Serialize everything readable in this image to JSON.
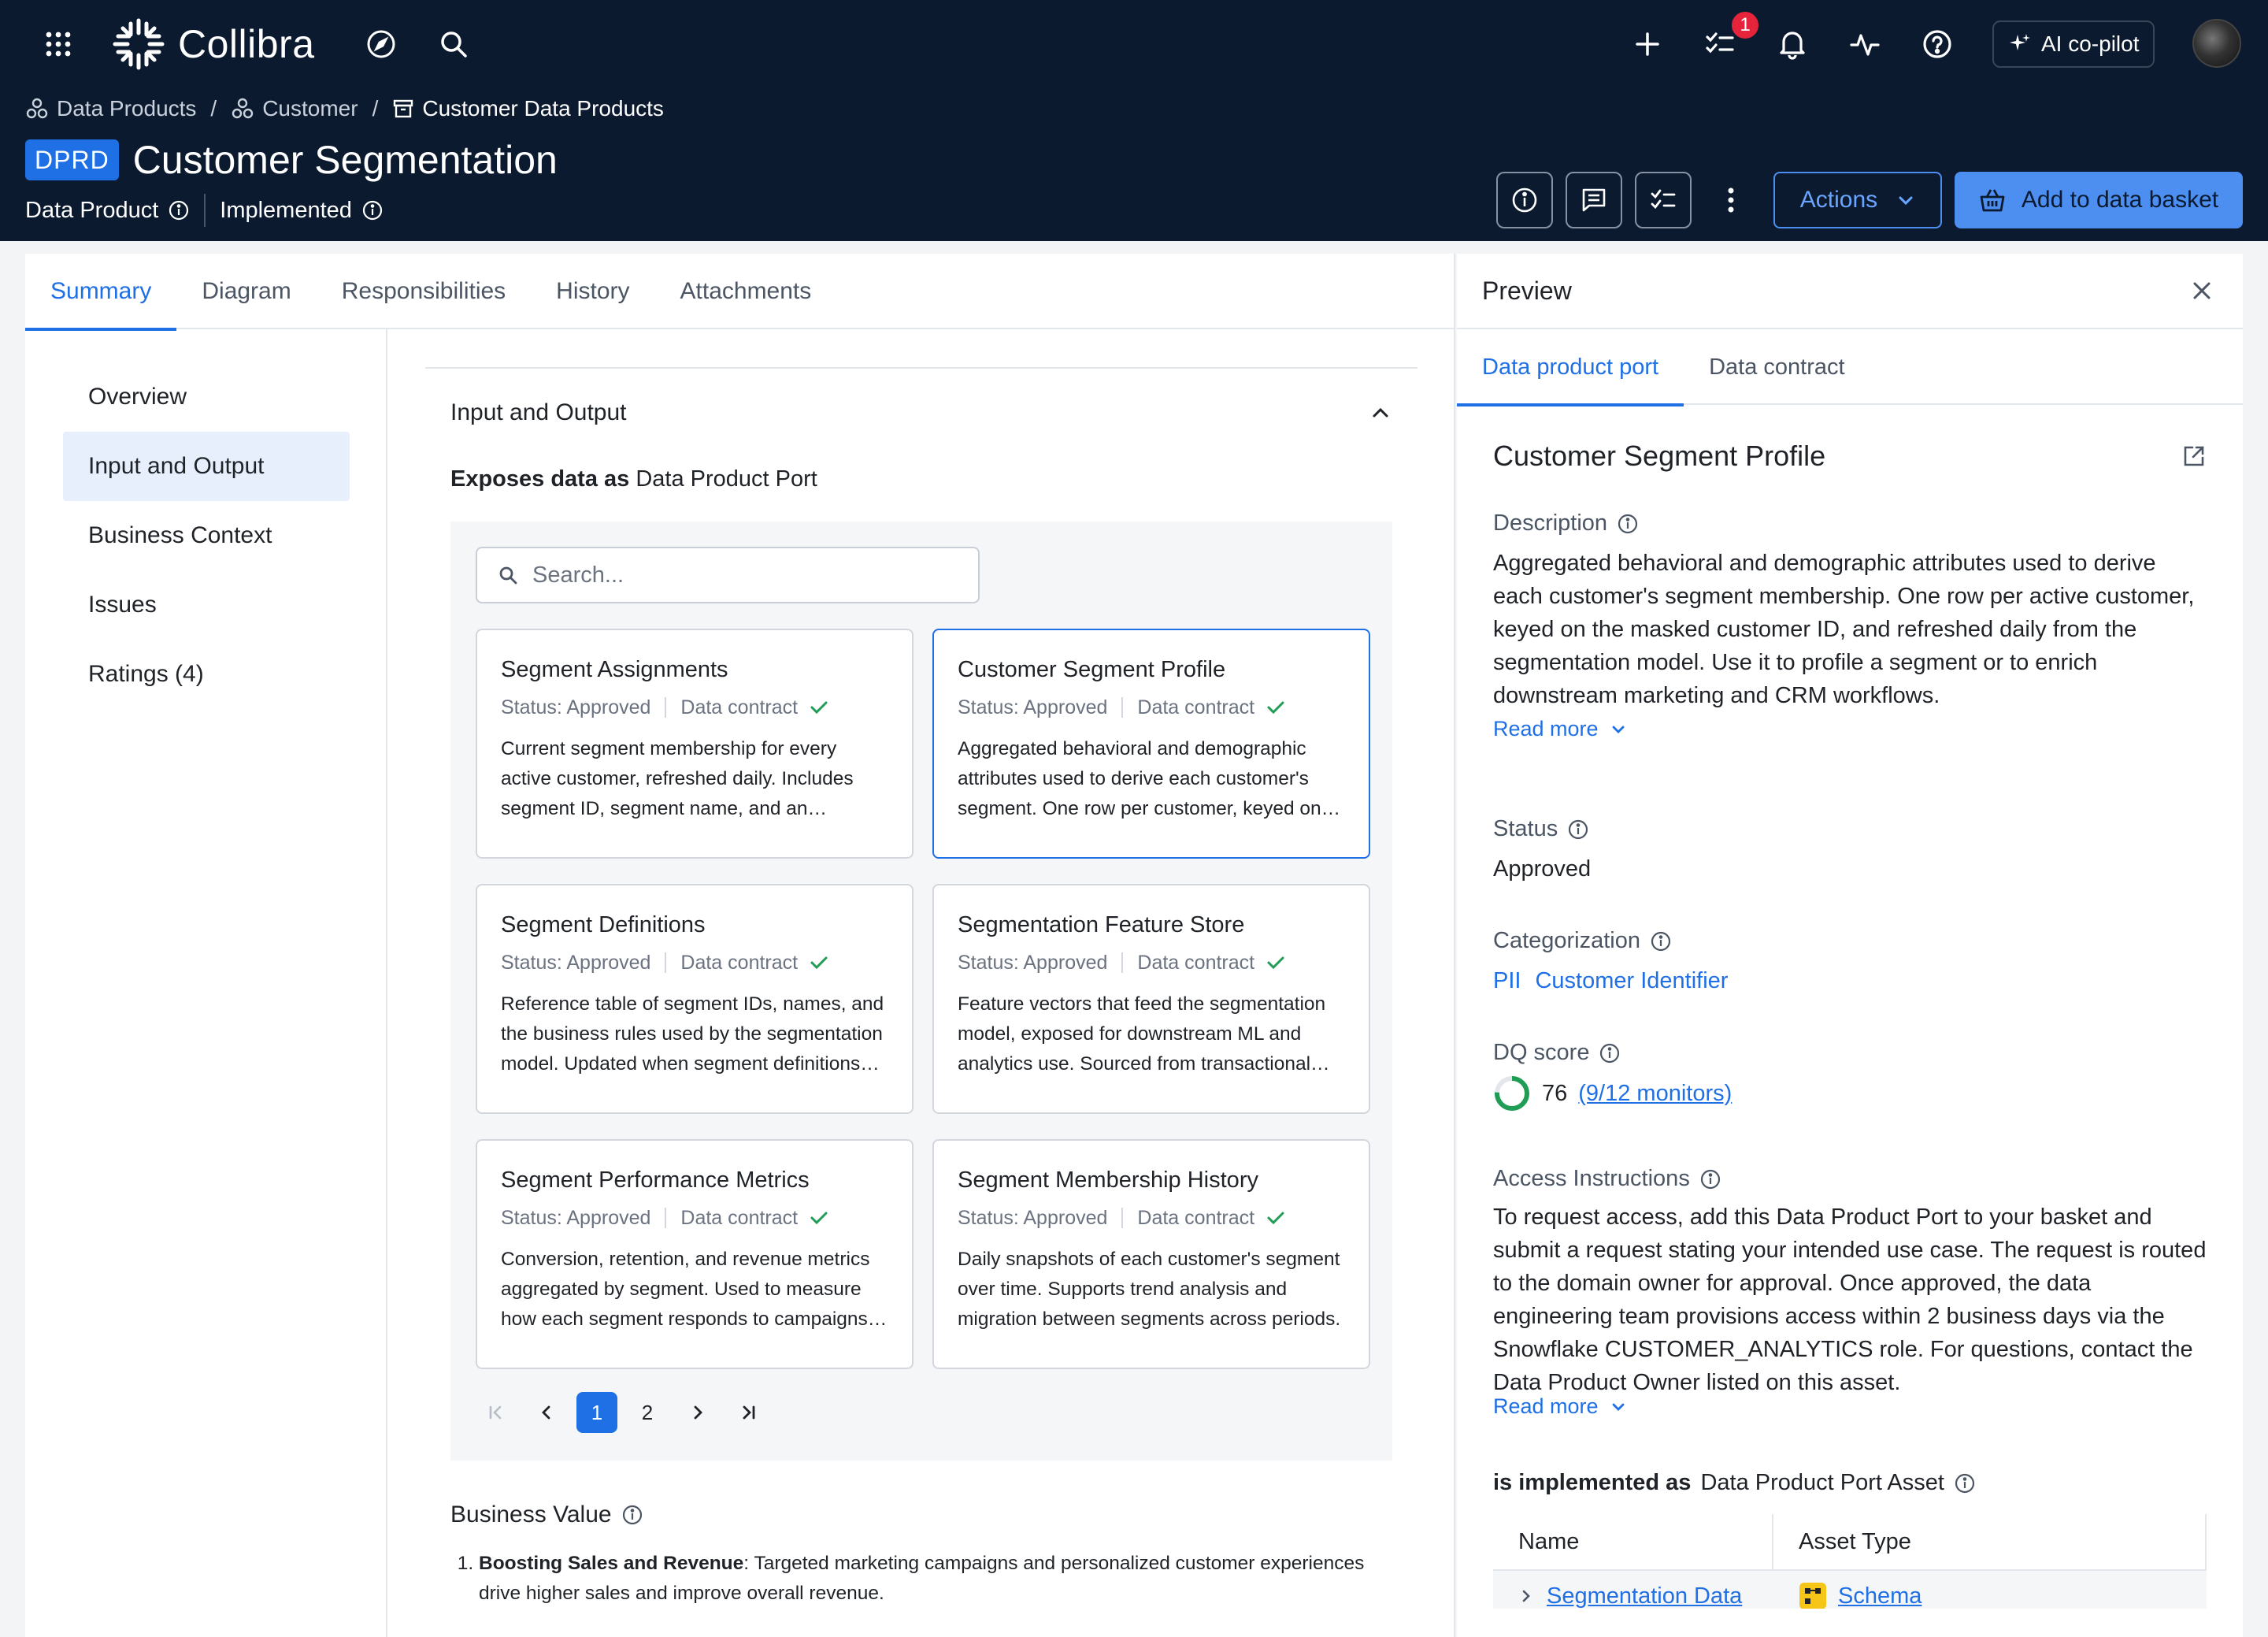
{
  "app": {
    "brand": "Collibra",
    "notifications_count": "1",
    "copilot_label": "AI co-pilot"
  },
  "breadcrumb": [
    {
      "label": "Data Products"
    },
    {
      "label": "Customer"
    },
    {
      "label": "Customer Data Products"
    }
  ],
  "asset": {
    "type_badge": "DPRD",
    "title": "Customer Segmentation",
    "type": "Data Product",
    "status": "Implemented"
  },
  "header_actions": {
    "actions_label": "Actions",
    "basket_label": "Add to data basket"
  },
  "tabs": [
    {
      "label": "Summary",
      "active": true
    },
    {
      "label": "Diagram"
    },
    {
      "label": "Responsibilities"
    },
    {
      "label": "History"
    },
    {
      "label": "Attachments"
    }
  ],
  "sidenav": [
    {
      "label": "Overview"
    },
    {
      "label": "Input and Output",
      "active": true
    },
    {
      "label": "Business Context"
    },
    {
      "label": "Issues"
    },
    {
      "label": "Ratings (4)"
    }
  ],
  "section": {
    "title": "Input and Output",
    "exposes_prefix": "Exposes data as",
    "exposes_type": "Data Product Port",
    "search_placeholder": "Search..."
  },
  "ports": [
    {
      "title": "Segment Assignments",
      "status": "Status: Approved",
      "contract": "Data contract",
      "desc": "Current segment membership for every active customer, refreshed daily. Includes segment ID, segment name, and an assignment timestamp for each customer record."
    },
    {
      "title": "Customer Segment Profile",
      "status": "Status: Approved",
      "contract": "Data contract",
      "desc": "Aggregated behavioral and demographic attributes used to derive each customer's segment. One row per customer, keyed on the masked customer ID.",
      "selected": true
    },
    {
      "title": "Segment Definitions",
      "status": "Status: Approved",
      "contract": "Data contract",
      "desc": "Reference table of segment IDs, names, and the business rules used by the segmentation model. Updated when segment definitions change."
    },
    {
      "title": "Segmentation Feature Store",
      "status": "Status: Approved",
      "contract": "Data contract",
      "desc": "Feature vectors that feed the segmentation model, exposed for downstream ML and analytics use. Sourced from transactional and behavioral data."
    },
    {
      "title": "Segment Performance Metrics",
      "status": "Status: Approved",
      "contract": "Data contract",
      "desc": "Conversion, retention, and revenue metrics aggregated by segment. Used to measure how each segment responds to campaigns over time."
    },
    {
      "title": "Segment Membership History",
      "status": "Status: Approved",
      "contract": "Data contract",
      "desc": "Daily snapshots of each customer's segment over time. Supports trend analysis and migration between segments across periods."
    }
  ],
  "pagination": {
    "pages": [
      "1",
      "2"
    ],
    "current": "1"
  },
  "business_value": {
    "title": "Business Value",
    "items": [
      {
        "bold": "Boosting Sales and Revenue",
        "text": ": Targeted marketing campaigns and personalized customer experiences drive higher sales and improve overall revenue."
      }
    ]
  },
  "preview": {
    "title": "Preview",
    "tabs": [
      {
        "label": "Data product port",
        "active": true
      },
      {
        "label": "Data contract"
      }
    ],
    "asset_name": "Customer Segment Profile",
    "description_label": "Description",
    "description": "Aggregated behavioral and demographic attributes used to derive each customer's segment membership. One row per active customer, keyed on the masked customer ID, and refreshed daily from the segmentation model. Use it to profile a segment or to enrich downstream marketing and CRM workflows.",
    "read_more": "Read more",
    "status_label": "Status",
    "status_value": "Approved",
    "categorization_label": "Categorization",
    "categorization": [
      "PII",
      "Customer Identifier"
    ],
    "dq_label": "DQ score",
    "dq_score": "76",
    "dq_score_fraction": 0.76,
    "dq_monitors": "(9/12 monitors)",
    "access_label": "Access Instructions",
    "access_text": "To request access, add this Data Product Port to your basket and submit a request stating your intended use case. The request is routed to the domain owner for approval. Once approved, the data engineering team provisions access within 2 business days via the Snowflake CUSTOMER_ANALYTICS role. For questions, contact the Data Product Owner listed on this asset.",
    "impl_prefix": "is implemented as",
    "impl_type": "Data Product Port Asset",
    "table_headers": [
      "Name",
      "Asset Type"
    ],
    "table_rows": [
      {
        "name": "Segmentation Data",
        "type": "Schema"
      }
    ]
  },
  "colors": {
    "header_bg": "#0b1a2f",
    "accent": "#1f6fe5",
    "success": "#1f9d55",
    "notification": "#e5243b"
  }
}
